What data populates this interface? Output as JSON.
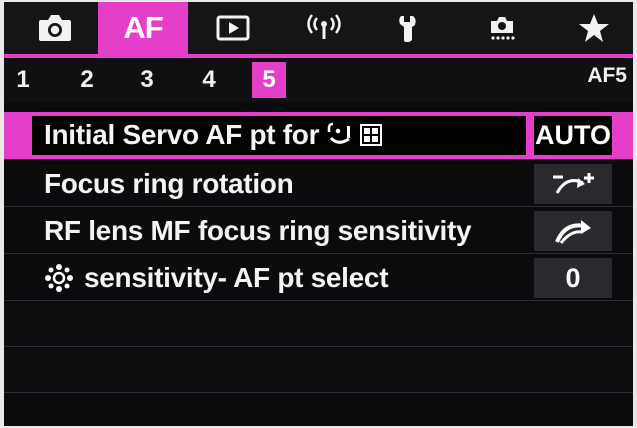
{
  "colors": {
    "accent": "#e43fc9",
    "background": "#0b0b0d",
    "text": "#f4f4f4"
  },
  "tabs": [
    {
      "icon": "camera-icon",
      "label": ""
    },
    {
      "icon": "af-tab",
      "label": "AF",
      "active": true
    },
    {
      "icon": "playback-icon",
      "label": ""
    },
    {
      "icon": "wireless-icon",
      "label": ""
    },
    {
      "icon": "wrench-icon",
      "label": ""
    },
    {
      "icon": "custom-functions-icon",
      "label": ""
    },
    {
      "icon": "star-icon",
      "label": ""
    }
  ],
  "pages": {
    "items": [
      "1",
      "2",
      "3",
      "4",
      "5"
    ],
    "active": "5",
    "menu_id": "AF5"
  },
  "menu": [
    {
      "label": "Initial Servo AF pt for",
      "label_icon": "face-tracking-zone-icon",
      "value": "AUTO",
      "selected": true
    },
    {
      "label": "Focus ring rotation",
      "value_icon": "focus-ring-rotation-icon"
    },
    {
      "label": "RF lens MF focus ring sensitivity",
      "value_icon": "ring-sensitivity-icon"
    },
    {
      "label": "sensitivity- AF pt select",
      "label_icon": "multi-controller-icon",
      "value": "0"
    }
  ]
}
